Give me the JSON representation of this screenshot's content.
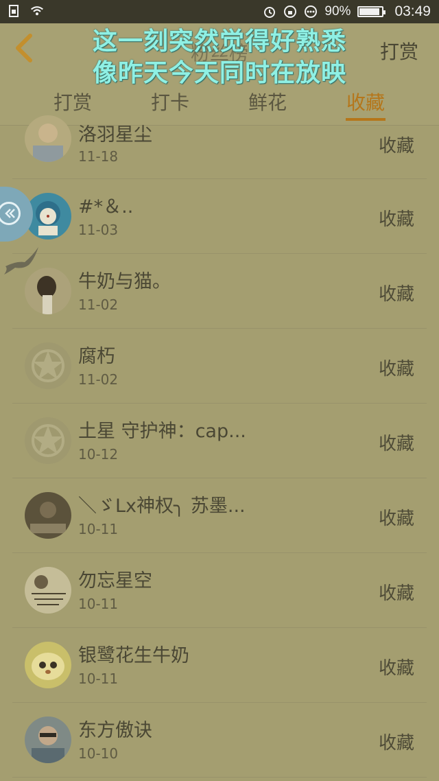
{
  "status_bar": {
    "battery_percent": "90%",
    "battery_level": 0.9,
    "time": "03:49"
  },
  "header": {
    "title": "粉丝榜",
    "right_label": "打赏"
  },
  "caption_overlay": {
    "line1": "这一刻突然觉得好熟悉",
    "line2": "像昨天今天同时在放映"
  },
  "tabs": [
    {
      "label": "打赏",
      "active": false
    },
    {
      "label": "打卡",
      "active": false
    },
    {
      "label": "鲜花",
      "active": false
    },
    {
      "label": "收藏",
      "active": true
    }
  ],
  "accent_color": "#b5761a",
  "items": [
    {
      "name": "洛羽星尘",
      "date": "11-18",
      "action": "收藏"
    },
    {
      "name": "#*＆..",
      "date": "11-03",
      "action": "收藏"
    },
    {
      "name": "牛奶与猫。",
      "date": "11-02",
      "action": "收藏"
    },
    {
      "name": "腐朽",
      "date": "11-02",
      "action": "收藏"
    },
    {
      "name": "土星 守护神：cap...",
      "date": "10-12",
      "action": "收藏"
    },
    {
      "name": "＼ゞLx神权╮ 苏墨...",
      "date": "10-11",
      "action": "收藏"
    },
    {
      "name": "勿忘星空",
      "date": "10-11",
      "action": "收藏"
    },
    {
      "name": "银鹭花生牛奶",
      "date": "10-11",
      "action": "收藏"
    },
    {
      "name": "东方傲诀",
      "date": "10-10",
      "action": "收藏"
    }
  ]
}
